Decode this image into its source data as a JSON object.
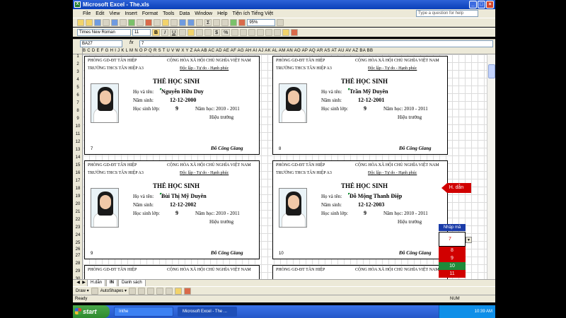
{
  "window": {
    "title": "Microsoft Excel - The.xls",
    "help_placeholder": "Type a question for help"
  },
  "menu": [
    "File",
    "Edit",
    "View",
    "Insert",
    "Format",
    "Tools",
    "Data",
    "Window",
    "Help",
    "Tiện ích Tiếng Việt"
  ],
  "toolbar": {
    "zoom": "95%",
    "font": "Times New Roman",
    "size": "11",
    "bold": "B",
    "italic": "I",
    "underline": "U",
    "currency": "$",
    "percent": "%"
  },
  "formula_bar": {
    "name_box": "BA27",
    "fx": "fx",
    "value": "7"
  },
  "grid": {
    "column_headers": "B C D E F G H I J K L M N O P Q R S T U V W X Y Z AA AB AC AD AE AF AG AH AI AJ AK AL AM AN AO AP AQ AR AS AT AU AV AZ BA BB",
    "rows": [
      "1",
      "2",
      "3",
      "4",
      "5",
      "6",
      "7",
      "8",
      "9",
      "10",
      "11",
      "12",
      "13",
      "14",
      "15",
      "16",
      "17",
      "18",
      "19",
      "20",
      "21",
      "22",
      "23",
      "24",
      "25",
      "26",
      "27",
      "28",
      "29",
      "30",
      "31",
      "32"
    ]
  },
  "card_labels": {
    "school_dept": "PHÒNG GD-ĐT TÂN HIỆP",
    "republic": "CỘNG HÒA XÃ HỘI CHỦ NGHĨA VIỆT NAM",
    "school": "TRƯỜNG THCS TÂN HIỆP A3",
    "motto": "Độc lập - Tự do - Hạnh phúc",
    "card_title": "THẺ HỌC SINH",
    "name_label": "Họ và tên:",
    "dob_label": "Năm sinh:",
    "class_label": "Học sinh lớp:",
    "year_label": "Năm học: 2010 - 2011",
    "principal": "Hiệu trưởng",
    "signature": "Đỗ Công Giang"
  },
  "cards": [
    {
      "name": "Nguyễn Hữu Duy",
      "dob": "12-12-2000",
      "class": "9",
      "number": "7"
    },
    {
      "name": "Trần Mỹ Duyên",
      "dob": "12-12-2001",
      "class": "9",
      "number": "8"
    },
    {
      "name": "Bùi Thị Mỹ Duyên",
      "dob": "12-12-2002",
      "class": "9",
      "number": "9"
    },
    {
      "name": "Đỗ Mộng Thanh Điệp",
      "dob": "12-12-2003",
      "class": "9",
      "number": "10"
    }
  ],
  "side_panel": {
    "guide_button": "H. dẫn",
    "code_header": "Nhập mã",
    "code_value": "7",
    "codes": [
      "8",
      "9",
      "10",
      "11"
    ],
    "code_colors": [
      "#d10000",
      "#d10000",
      "#1f8a3a",
      "#d10000"
    ]
  },
  "sheet_tabs": {
    "tabs": [
      "H.dẫn",
      "IN",
      "Danh sách"
    ],
    "active": "IN"
  },
  "draw_bar": {
    "draw": "Draw ▾",
    "autoshapes": "AutoShapes ▾"
  },
  "status": {
    "left": "Ready",
    "right": "NUM"
  },
  "taskbar": {
    "start": "start",
    "tasks": [
      "Inthe",
      "Microsoft Excel - The ..."
    ],
    "clock": "10:39 AM"
  }
}
